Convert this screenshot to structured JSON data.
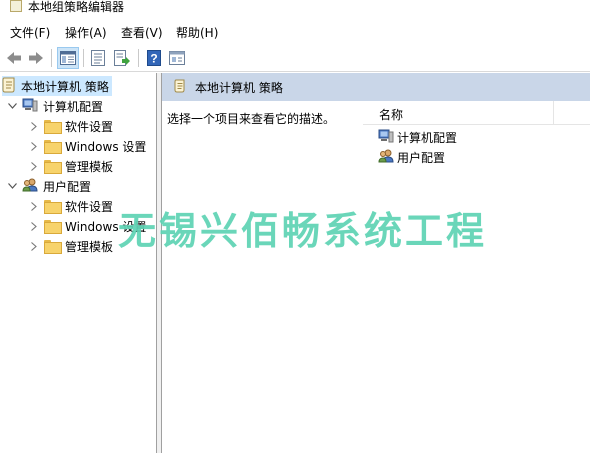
{
  "window": {
    "title": "本地组策略编辑器"
  },
  "menubar": {
    "items": [
      "文件(F)",
      "操作(A)",
      "查看(V)",
      "帮助(H)"
    ]
  },
  "toolbar": {
    "buttons": [
      "back-arrow-icon",
      "forward-arrow-icon",
      "show-hide-tree-icon",
      "properties-icon",
      "export-list-icon",
      "help-icon",
      "filter-view-icon"
    ]
  },
  "tree": {
    "root": "本地计算机 策略",
    "computer": {
      "label": "计算机配置",
      "children": [
        "软件设置",
        "Windows 设置",
        "管理模板"
      ]
    },
    "user": {
      "label": "用户配置",
      "children": [
        "软件设置",
        "Windows 设置",
        "管理模板"
      ]
    }
  },
  "main": {
    "header": "本地计算机 策略",
    "description": "选择一个项目来查看它的描述。",
    "column_name": "名称",
    "items": [
      "计算机配置",
      "用户配置"
    ]
  },
  "watermark": "无锡兴佰畅系统工程",
  "colors": {
    "selection": "#cce8ff",
    "header_band": "#c9d6e8",
    "watermark": "#5ed3b4"
  }
}
